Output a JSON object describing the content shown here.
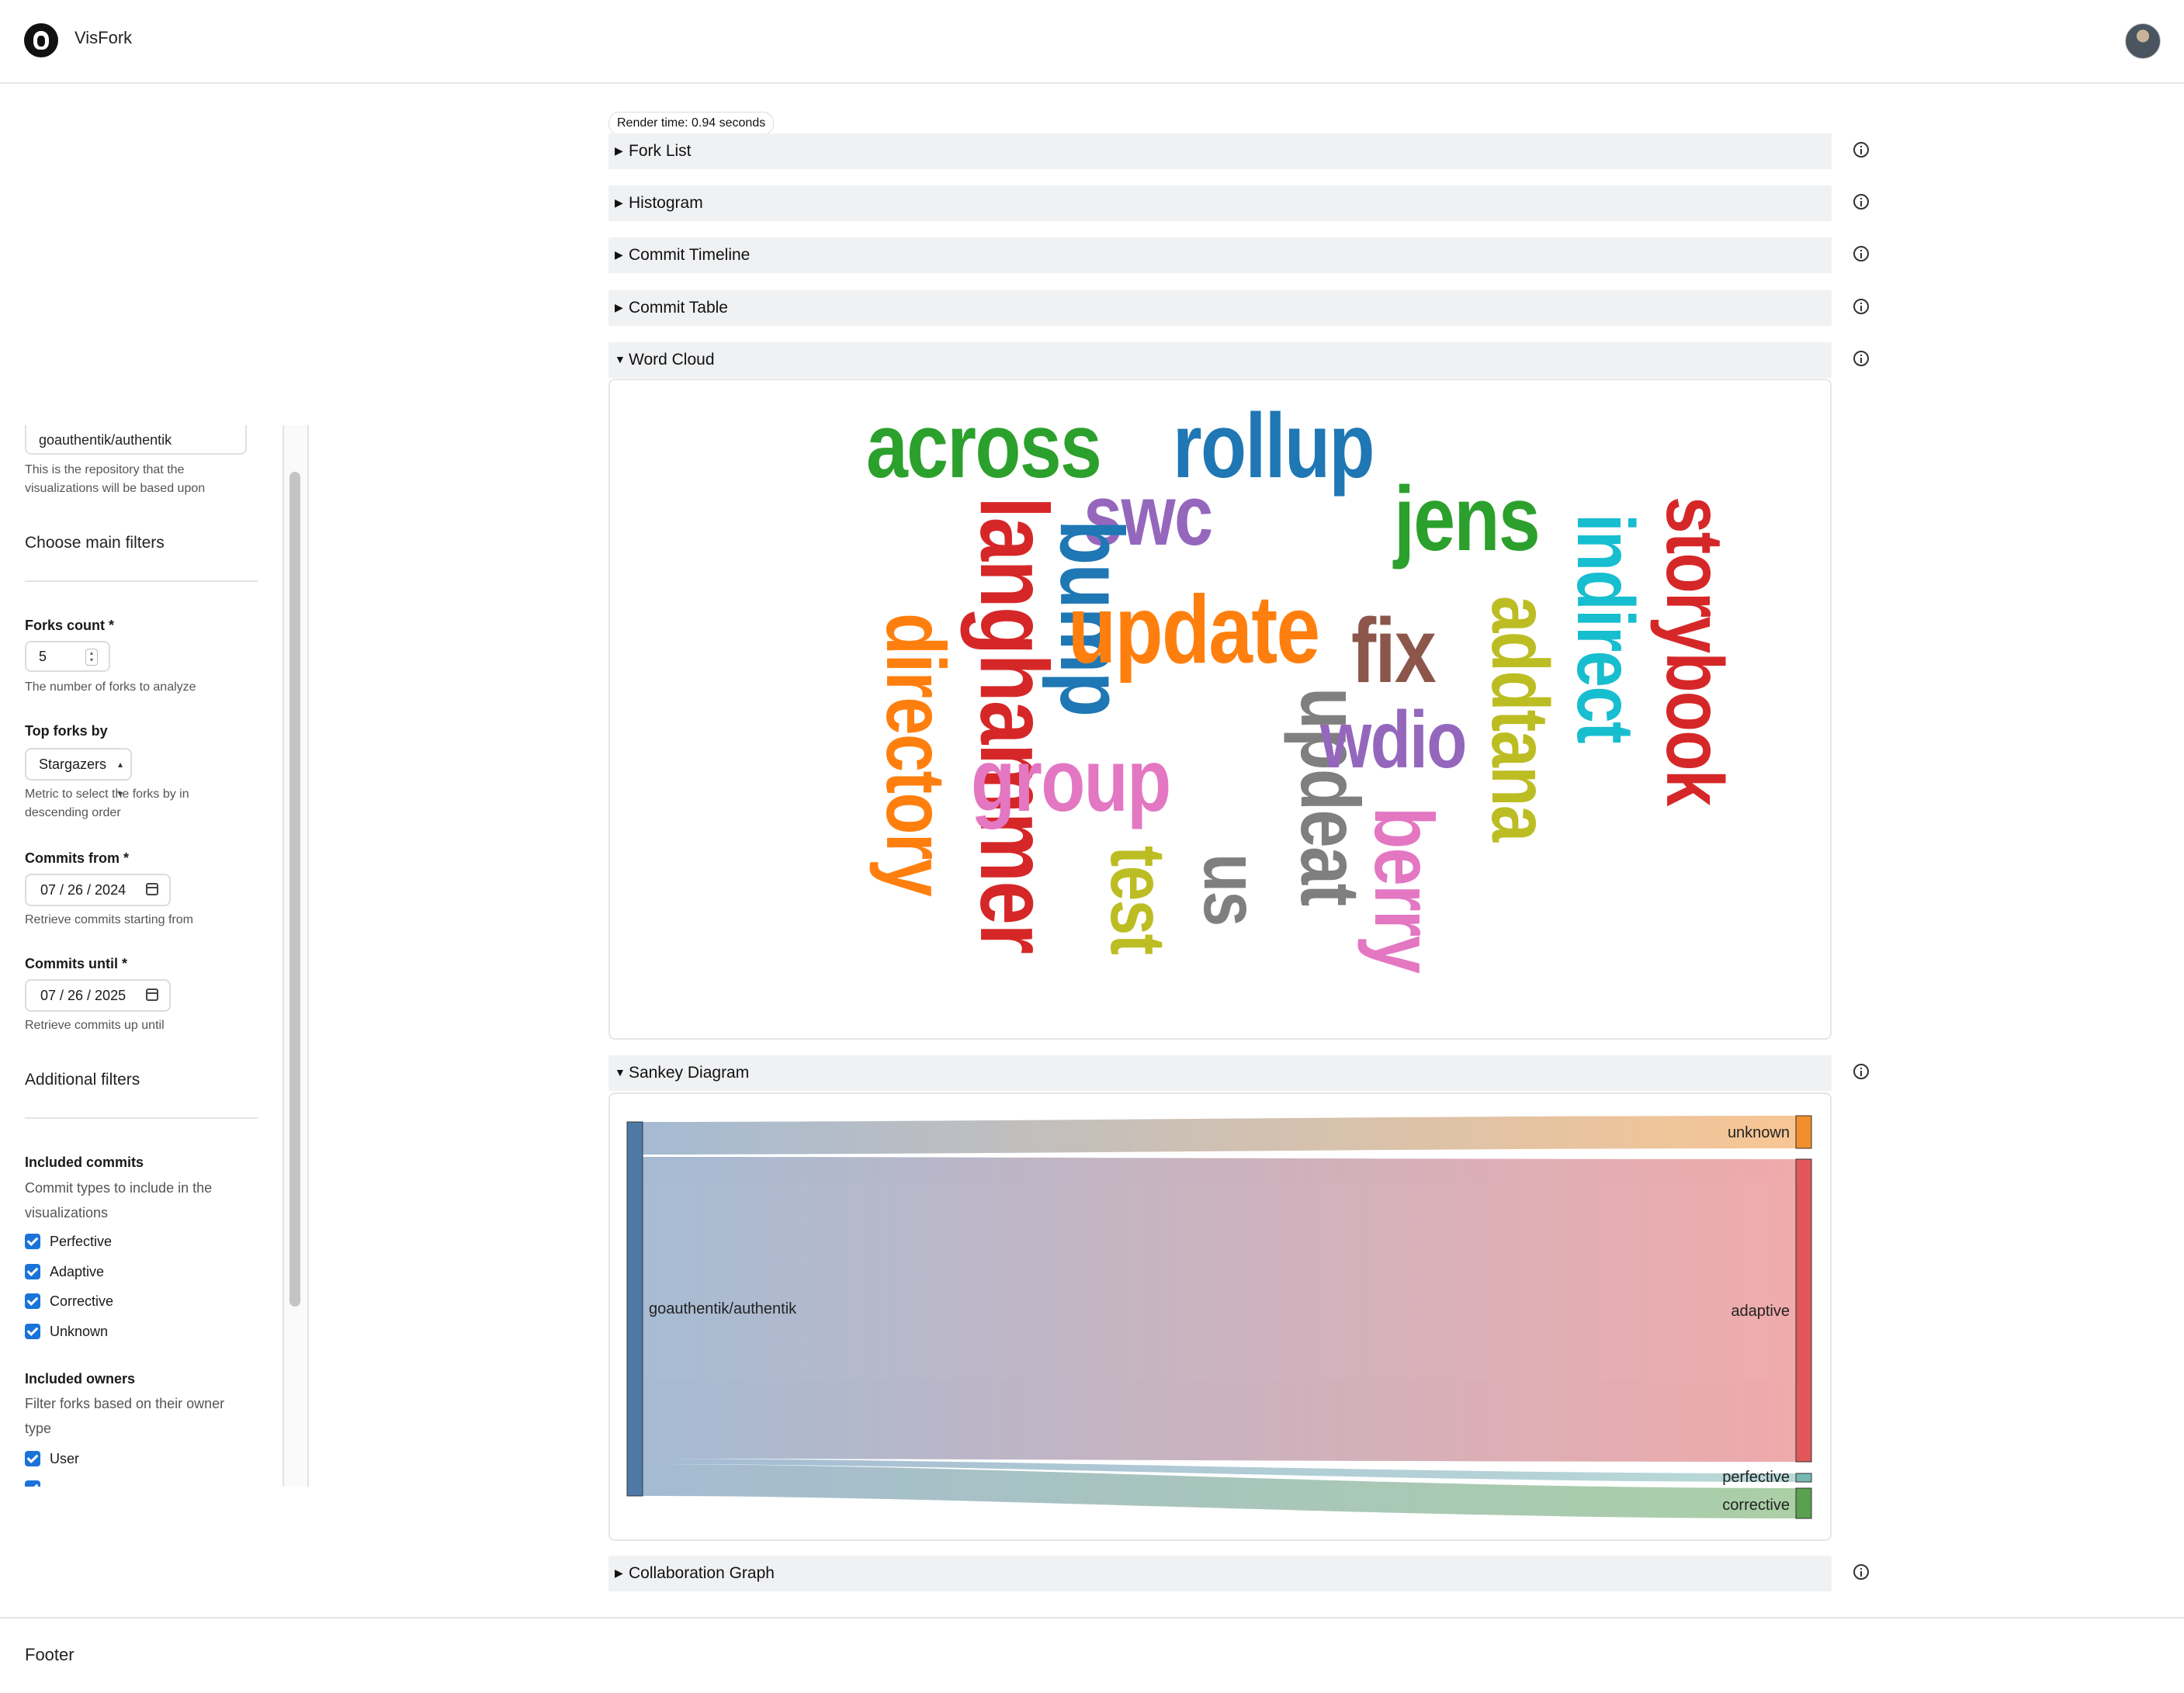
{
  "header": {
    "brand": "VisFork"
  },
  "sidebar": {
    "repo_value": "goauthentik/authentik",
    "repo_help": [
      "This is the repository that the",
      "visualizations will be based upon"
    ],
    "main_filters_title": "Choose main filters",
    "forks_count_label": "Forks count *",
    "forks_count_value": "5",
    "forks_count_help": "The number of forks to analyze",
    "top_forks_label": "Top forks by",
    "top_forks_value": "Stargazers",
    "top_forks_help": [
      "Metric to select the forks by in",
      "descending order"
    ],
    "commits_from_label": "Commits from *",
    "commits_from_value": "07 / 26 / 2024",
    "commits_from_help": "Retrieve commits starting from",
    "commits_until_label": "Commits until *",
    "commits_until_value": "07 / 26 / 2025",
    "commits_until_help": "Retrieve commits up until",
    "additional_filters_title": "Additional filters",
    "included_commits_label": "Included commits",
    "included_commits_help": [
      "Commit types to include in the",
      "visualizations"
    ],
    "commit_types": [
      "Perfective",
      "Adaptive",
      "Corrective",
      "Unknown"
    ],
    "included_owners_label": "Included owners",
    "included_owners_help": [
      "Filter forks based on their owner",
      "type"
    ],
    "owner_types": [
      "User"
    ]
  },
  "main": {
    "render_time": "Render time: 0.94 seconds",
    "panels": [
      "Fork List",
      "Histogram",
      "Commit Timeline",
      "Commit Table",
      "Word Cloud",
      "Sankey Diagram",
      "Collaboration Graph"
    ],
    "word_cloud": {
      "words": [
        "across",
        "rollup",
        "swc",
        "jens",
        "indirect",
        "storybook",
        "langhammer",
        "bump",
        "update",
        "fix",
        "addtana",
        "directory",
        "updeat",
        "wdio",
        "group",
        "test",
        "us",
        "berry"
      ],
      "colors": {
        "green": "#2ca02c",
        "blue": "#1f77b4",
        "purple": "#9467bd",
        "red": "#d62728",
        "orange": "#ff7f0e",
        "brown": "#8c564b",
        "olive": "#bcbd22",
        "cyan": "#17becf",
        "pink": "#e377c2",
        "gray": "#7f7f7f"
      }
    },
    "sankey": {
      "source": "goauthentik/authentik",
      "targets": [
        {
          "name": "unknown",
          "color": "#f28e2b"
        },
        {
          "name": "adaptive",
          "color": "#e15759"
        },
        {
          "name": "perfective",
          "color": "#76b7b2"
        },
        {
          "name": "corrective",
          "color": "#59a14f"
        }
      ],
      "source_color": "#4e79a7"
    }
  },
  "footer": {
    "text": "Footer"
  }
}
